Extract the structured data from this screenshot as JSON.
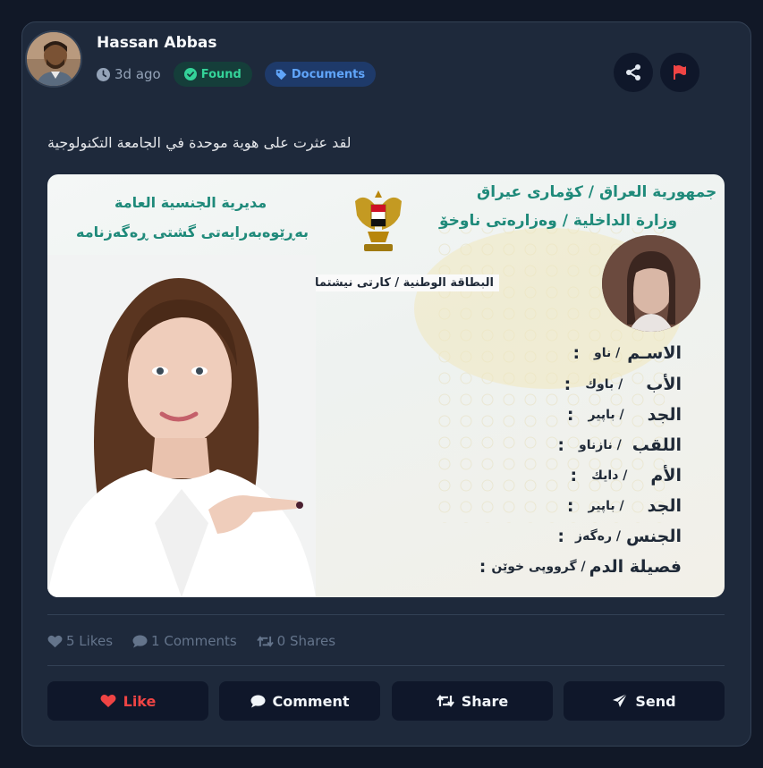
{
  "post": {
    "author": "Hassan Abbas",
    "time": "3d ago",
    "status_badge": "Found",
    "category_badge": "Documents",
    "text": "لقد عثرت على هوية موحدة في الجامعة التكنولوجية"
  },
  "id_card": {
    "header_right_1": "جمهورية العراق / كۆماری عیراق",
    "header_right_2": "وزارة الداخلية / وەزارەتی ناوخۆ",
    "header_left_1": "مديرية الجنسية العامة",
    "header_left_2": "بەڕێوەبەرایەتی گشتی ڕەگەزنامە",
    "card_title": "البطاقة الوطنية / كارتى نيشتمانى",
    "fields": [
      {
        "label": "الاسـم",
        "kurdish": "/ ناو",
        "colon": ":"
      },
      {
        "label": "الأب",
        "kurdish": "/ باوك",
        "colon": ":"
      },
      {
        "label": "الجد",
        "kurdish": "/ باپير",
        "colon": ":"
      },
      {
        "label": "اللقب",
        "kurdish": "/ نازناو",
        "colon": ":"
      },
      {
        "label": "الأم",
        "kurdish": "/ دايك",
        "colon": ":"
      },
      {
        "label": "الجد",
        "kurdish": "/ باپير",
        "colon": ":"
      },
      {
        "label": "الجنس",
        "kurdish": "/ رەگەز",
        "colon": ":"
      },
      {
        "label": "فصيلة الدم",
        "kurdish": "/ گرووپى خوێن",
        "colon": ":"
      }
    ]
  },
  "stats": {
    "likes": "5 Likes",
    "comments": "1 Comments",
    "shares": "0 Shares"
  },
  "actions": {
    "like": "Like",
    "comment": "Comment",
    "share": "Share",
    "send": "Send"
  },
  "colors": {
    "background": "#111827",
    "card": "#1e293b",
    "button": "#0f172a",
    "like_red": "#ef4444",
    "found_green": "#34d399",
    "documents_blue": "#60a5fa",
    "flag_red": "#ef4444"
  }
}
